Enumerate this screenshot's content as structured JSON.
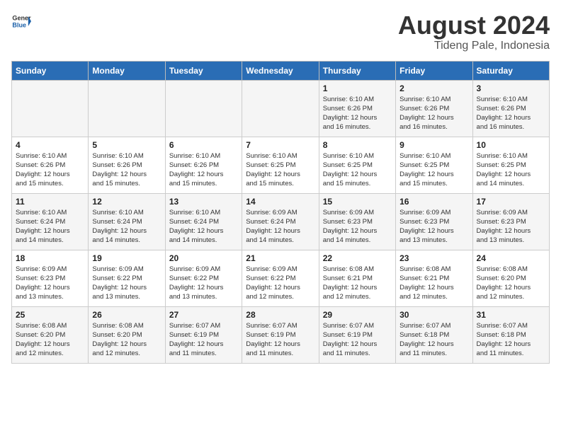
{
  "header": {
    "logo_line1": "General",
    "logo_line2": "Blue",
    "title": "August 2024",
    "subtitle": "Tideng Pale, Indonesia"
  },
  "days_of_week": [
    "Sunday",
    "Monday",
    "Tuesday",
    "Wednesday",
    "Thursday",
    "Friday",
    "Saturday"
  ],
  "weeks": [
    [
      {
        "date": "",
        "info": ""
      },
      {
        "date": "",
        "info": ""
      },
      {
        "date": "",
        "info": ""
      },
      {
        "date": "",
        "info": ""
      },
      {
        "date": "1",
        "info": "Sunrise: 6:10 AM\nSunset: 6:26 PM\nDaylight: 12 hours\nand 16 minutes."
      },
      {
        "date": "2",
        "info": "Sunrise: 6:10 AM\nSunset: 6:26 PM\nDaylight: 12 hours\nand 16 minutes."
      },
      {
        "date": "3",
        "info": "Sunrise: 6:10 AM\nSunset: 6:26 PM\nDaylight: 12 hours\nand 16 minutes."
      }
    ],
    [
      {
        "date": "4",
        "info": "Sunrise: 6:10 AM\nSunset: 6:26 PM\nDaylight: 12 hours\nand 15 minutes."
      },
      {
        "date": "5",
        "info": "Sunrise: 6:10 AM\nSunset: 6:26 PM\nDaylight: 12 hours\nand 15 minutes."
      },
      {
        "date": "6",
        "info": "Sunrise: 6:10 AM\nSunset: 6:26 PM\nDaylight: 12 hours\nand 15 minutes."
      },
      {
        "date": "7",
        "info": "Sunrise: 6:10 AM\nSunset: 6:25 PM\nDaylight: 12 hours\nand 15 minutes."
      },
      {
        "date": "8",
        "info": "Sunrise: 6:10 AM\nSunset: 6:25 PM\nDaylight: 12 hours\nand 15 minutes."
      },
      {
        "date": "9",
        "info": "Sunrise: 6:10 AM\nSunset: 6:25 PM\nDaylight: 12 hours\nand 15 minutes."
      },
      {
        "date": "10",
        "info": "Sunrise: 6:10 AM\nSunset: 6:25 PM\nDaylight: 12 hours\nand 14 minutes."
      }
    ],
    [
      {
        "date": "11",
        "info": "Sunrise: 6:10 AM\nSunset: 6:24 PM\nDaylight: 12 hours\nand 14 minutes."
      },
      {
        "date": "12",
        "info": "Sunrise: 6:10 AM\nSunset: 6:24 PM\nDaylight: 12 hours\nand 14 minutes."
      },
      {
        "date": "13",
        "info": "Sunrise: 6:10 AM\nSunset: 6:24 PM\nDaylight: 12 hours\nand 14 minutes."
      },
      {
        "date": "14",
        "info": "Sunrise: 6:09 AM\nSunset: 6:24 PM\nDaylight: 12 hours\nand 14 minutes."
      },
      {
        "date": "15",
        "info": "Sunrise: 6:09 AM\nSunset: 6:23 PM\nDaylight: 12 hours\nand 14 minutes."
      },
      {
        "date": "16",
        "info": "Sunrise: 6:09 AM\nSunset: 6:23 PM\nDaylight: 12 hours\nand 13 minutes."
      },
      {
        "date": "17",
        "info": "Sunrise: 6:09 AM\nSunset: 6:23 PM\nDaylight: 12 hours\nand 13 minutes."
      }
    ],
    [
      {
        "date": "18",
        "info": "Sunrise: 6:09 AM\nSunset: 6:23 PM\nDaylight: 12 hours\nand 13 minutes."
      },
      {
        "date": "19",
        "info": "Sunrise: 6:09 AM\nSunset: 6:22 PM\nDaylight: 12 hours\nand 13 minutes."
      },
      {
        "date": "20",
        "info": "Sunrise: 6:09 AM\nSunset: 6:22 PM\nDaylight: 12 hours\nand 13 minutes."
      },
      {
        "date": "21",
        "info": "Sunrise: 6:09 AM\nSunset: 6:22 PM\nDaylight: 12 hours\nand 12 minutes."
      },
      {
        "date": "22",
        "info": "Sunrise: 6:08 AM\nSunset: 6:21 PM\nDaylight: 12 hours\nand 12 minutes."
      },
      {
        "date": "23",
        "info": "Sunrise: 6:08 AM\nSunset: 6:21 PM\nDaylight: 12 hours\nand 12 minutes."
      },
      {
        "date": "24",
        "info": "Sunrise: 6:08 AM\nSunset: 6:20 PM\nDaylight: 12 hours\nand 12 minutes."
      }
    ],
    [
      {
        "date": "25",
        "info": "Sunrise: 6:08 AM\nSunset: 6:20 PM\nDaylight: 12 hours\nand 12 minutes."
      },
      {
        "date": "26",
        "info": "Sunrise: 6:08 AM\nSunset: 6:20 PM\nDaylight: 12 hours\nand 12 minutes."
      },
      {
        "date": "27",
        "info": "Sunrise: 6:07 AM\nSunset: 6:19 PM\nDaylight: 12 hours\nand 11 minutes."
      },
      {
        "date": "28",
        "info": "Sunrise: 6:07 AM\nSunset: 6:19 PM\nDaylight: 12 hours\nand 11 minutes."
      },
      {
        "date": "29",
        "info": "Sunrise: 6:07 AM\nSunset: 6:19 PM\nDaylight: 12 hours\nand 11 minutes."
      },
      {
        "date": "30",
        "info": "Sunrise: 6:07 AM\nSunset: 6:18 PM\nDaylight: 12 hours\nand 11 minutes."
      },
      {
        "date": "31",
        "info": "Sunrise: 6:07 AM\nSunset: 6:18 PM\nDaylight: 12 hours\nand 11 minutes."
      }
    ]
  ]
}
